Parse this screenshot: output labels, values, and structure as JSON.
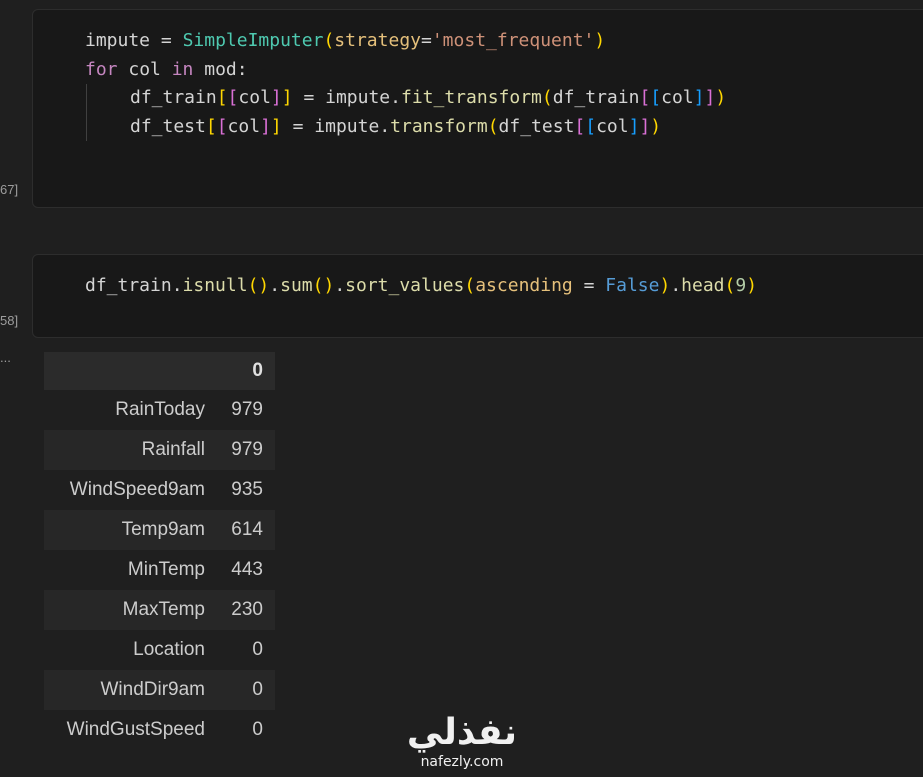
{
  "cells": [
    {
      "execution_count": "67]",
      "code_lines": [
        "impute = SimpleImputer(strategy='most_frequent')",
        "for col in mod:",
        "    df_train[[col]] = impute.fit_transform(df_train[[col]])",
        "    df_test[[col]] = impute.transform(df_test[[col]])"
      ]
    },
    {
      "execution_count": "58]",
      "code_lines": [
        "df_train.isnull().sum().sort_values(ascending = False).head(9)"
      ]
    }
  ],
  "output": {
    "prompt": "...",
    "table": {
      "column_header": "0",
      "rows": [
        {
          "label": "RainToday",
          "value": "979"
        },
        {
          "label": "Rainfall",
          "value": "979"
        },
        {
          "label": "WindSpeed9am",
          "value": "935"
        },
        {
          "label": "Temp9am",
          "value": "614"
        },
        {
          "label": "MinTemp",
          "value": "443"
        },
        {
          "label": "MaxTemp",
          "value": "230"
        },
        {
          "label": "Location",
          "value": "0"
        },
        {
          "label": "WindDir9am",
          "value": "0"
        },
        {
          "label": "WindGustSpeed",
          "value": "0"
        }
      ]
    }
  },
  "watermark": {
    "logo_text": "نفذلي",
    "url": "nafezly.com"
  },
  "colors": {
    "background": "#1f1f1f",
    "cell_background": "#181818",
    "class": "#4ec9b0",
    "function": "#dcdcaa",
    "keyword": "#c586c0",
    "string": "#ce9178",
    "number": "#b5cea8",
    "boolean": "#569cd6"
  }
}
